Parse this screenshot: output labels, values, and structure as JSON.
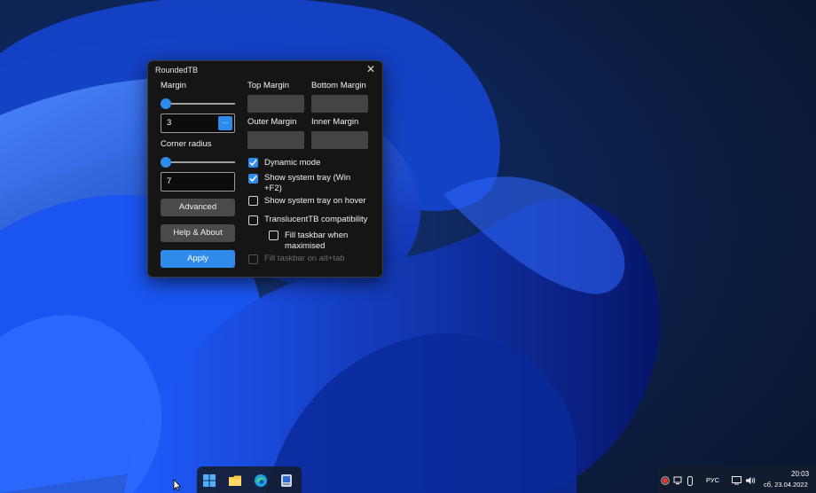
{
  "window": {
    "title": "RoundedTB",
    "close_glyph": "✕"
  },
  "left": {
    "margin_label": "Margin",
    "margin_value": "3",
    "margin_button": "...",
    "corner_radius_label": "Corner radius",
    "corner_radius_value": "7",
    "advanced_button": "Advanced",
    "help_button": "Help & About",
    "apply_button": "Apply"
  },
  "right": {
    "top_margin_label": "Top Margin",
    "bottom_margin_label": "Bottom Margin",
    "outer_margin_label": "Outer Margin",
    "inner_margin_label": "Inner Margin"
  },
  "options": {
    "dynamic_mode": "Dynamic mode",
    "show_tray_line1": "Show system tray (Win",
    "show_tray_line2": "+F2)",
    "show_tray_hover": "Show system tray on hover",
    "translucent": "TranslucentTB compatibility",
    "fill_max_line1": "Fill taskbar when",
    "fill_max_line2": "maximised",
    "fill_alt_tab": "Fill taskbar on alt+tab",
    "states": {
      "dynamic_mode": true,
      "show_tray": true,
      "show_tray_hover": false,
      "translucent": false,
      "fill_max": false,
      "fill_alt_tab": false
    }
  },
  "taskbar": {
    "icons": [
      "windows-start-icon",
      "file-explorer-icon",
      "edge-icon",
      "roundedtb-app-icon"
    ]
  },
  "tray": {
    "language": "РУС",
    "time": "20:03",
    "date": "сб, 23.04.2022"
  },
  "colors": {
    "accent": "#2f8bea",
    "window_bg": "#151515",
    "button_bg": "#4a4a4a"
  }
}
